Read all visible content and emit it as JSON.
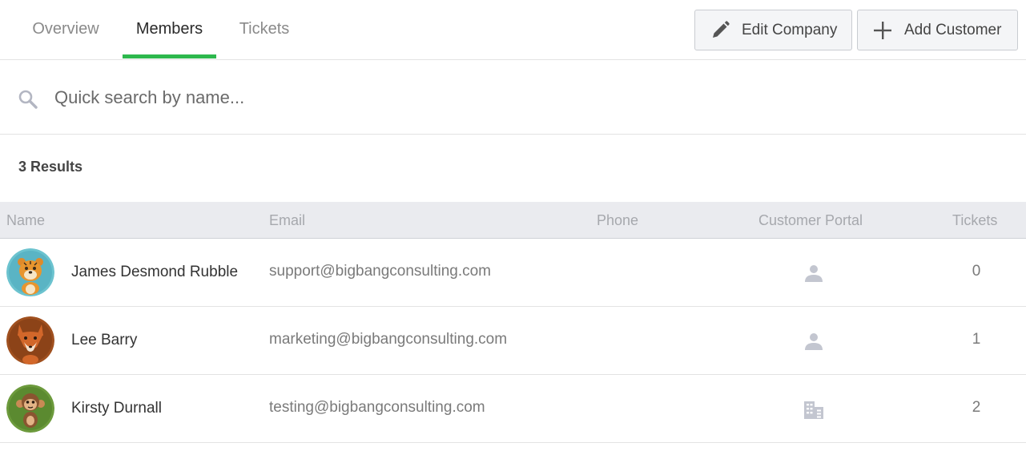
{
  "tabs": [
    {
      "label": "Overview",
      "active": false
    },
    {
      "label": "Members",
      "active": true
    },
    {
      "label": "Tickets",
      "active": false
    }
  ],
  "toolbar": {
    "edit_label": "Edit Company",
    "edit_icon": "pencil-icon",
    "add_label": "Add Customer",
    "add_icon": "plus-icon"
  },
  "search": {
    "placeholder": "Quick search by name...",
    "value": "",
    "icon": "search-icon"
  },
  "results_label": "3 Results",
  "table": {
    "columns": [
      "Name",
      "Email",
      "Phone",
      "Customer Portal",
      "Tickets"
    ],
    "rows": [
      {
        "name": "James Desmond Rubble",
        "email": "support@bigbangconsulting.com",
        "phone": "",
        "portal_icon": "person-icon",
        "tickets": "0",
        "avatar": "tiger-avatar"
      },
      {
        "name": "Lee Barry",
        "email": "marketing@bigbangconsulting.com",
        "phone": "",
        "portal_icon": "person-icon",
        "tickets": "1",
        "avatar": "fox-avatar"
      },
      {
        "name": "Kirsty Durnall",
        "email": "testing@bigbangconsulting.com",
        "phone": "",
        "portal_icon": "building-icon",
        "tickets": "2",
        "avatar": "monkey-avatar"
      }
    ]
  },
  "colors": {
    "accent": "#2db84d",
    "header_bg": "#eaebef",
    "icon_gray": "#c3c6d0"
  }
}
